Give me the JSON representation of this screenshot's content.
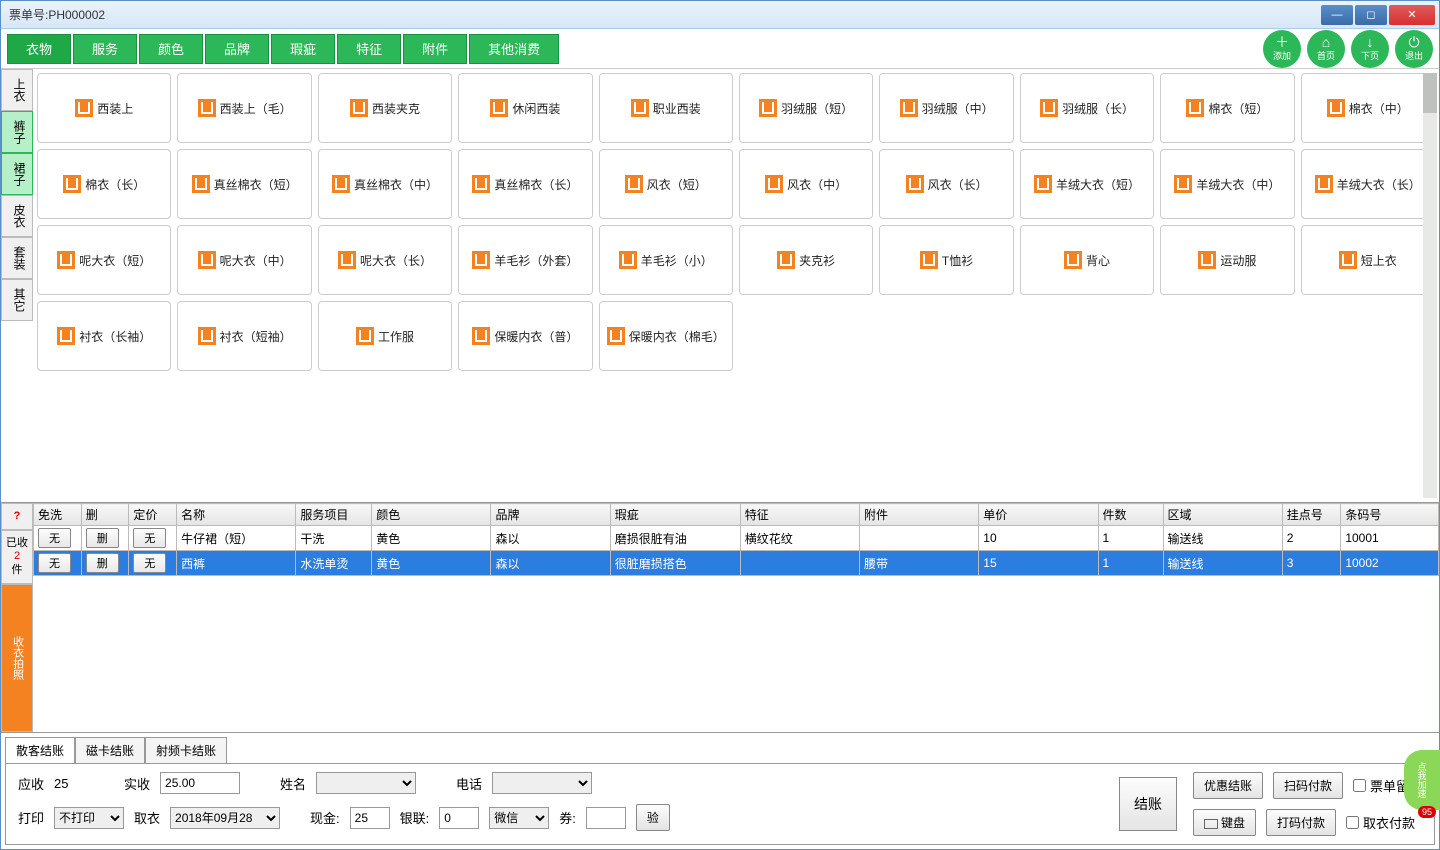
{
  "title": "票单号:PH000002",
  "tabs": [
    "衣物",
    "服务",
    "颜色",
    "品牌",
    "瑕疵",
    "特征",
    "附件",
    "其他消费"
  ],
  "circleBtns": {
    "add": "添加",
    "home": "首页",
    "next": "下页",
    "exit": "退出"
  },
  "catTabs": [
    "上衣",
    "裤子",
    "裙子",
    "皮衣",
    "套装",
    "其它"
  ],
  "items": [
    "西装上",
    "西装上（毛）",
    "西装夹克",
    "休闲西装",
    "职业西装",
    "羽绒服（短）",
    "羽绒服（中）",
    "羽绒服（长）",
    "棉衣（短）",
    "棉衣（中）",
    "棉衣（长）",
    "真丝棉衣（短）",
    "真丝棉衣（中）",
    "真丝棉衣（长）",
    "风衣（短）",
    "风衣（中）",
    "风衣（长）",
    "羊绒大衣（短）",
    "羊绒大衣（中）",
    "羊绒大衣（长）",
    "呢大衣（短）",
    "呢大衣（中）",
    "呢大衣（长）",
    "羊毛衫（外套）",
    "羊毛衫（小）",
    "夹克衫",
    "T恤衫",
    "背心",
    "运动服",
    "短上衣",
    "衬衣（长袖）",
    "衬衣（短袖）",
    "工作服",
    "保暖内衣（普）",
    "保暖内衣（棉毛）"
  ],
  "tableHeaders": [
    "免洗",
    "删",
    "定价",
    "名称",
    "服务项目",
    "颜色",
    "品牌",
    "瑕疵",
    "特征",
    "附件",
    "单价",
    "件数",
    "区域",
    "挂点号",
    "条码号"
  ],
  "qMark": "?",
  "rows": [
    {
      "name": "牛仔裙（短）",
      "serv": "干洗",
      "color": "黄色",
      "brand": "森以",
      "flaw": "磨损很脏有油",
      "feat": "横纹花纹",
      "acc": "",
      "price": "10",
      "qty": "1",
      "area": "输送线",
      "hook": "2",
      "barcode": "10001",
      "sel": false
    },
    {
      "name": "西裤",
      "serv": "水洗单烫",
      "color": "黄色",
      "brand": "森以",
      "flaw": "很脏磨损搭色",
      "feat": "",
      "acc": "腰带",
      "price": "15",
      "qty": "1",
      "area": "输送线",
      "hook": "3",
      "barcode": "10002",
      "sel": true
    }
  ],
  "miniBtns": {
    "none": "无",
    "del": "删"
  },
  "sideTabs": {
    "received": "已收",
    "count": "2",
    "unit": "件",
    "photo": "收衣拍照"
  },
  "checkoutTabs": [
    "散客结账",
    "磁卡结账",
    "射频卡结账"
  ],
  "checkout": {
    "dueLabel": "应收",
    "dueVal": "25",
    "recvLabel": "实收",
    "recvVal": "25.00",
    "nameLabel": "姓名",
    "phoneLabel": "电话",
    "printLabel": "打印",
    "printVal": "不打印",
    "pickLabel": "取衣",
    "pickVal": "2018年09月28",
    "cashLabel": "现金:",
    "cashVal": "25",
    "bankLabel": "银联:",
    "bankVal": "0",
    "wechatLabel": "微信",
    "couponLabel": "券:",
    "verify": "验",
    "settle": "结账",
    "discount": "优惠结账",
    "scanpay": "扫码付款",
    "keepTicket": "票单留店",
    "keyboard": "键盘",
    "codepay": "打码付款",
    "pickupPay": "取衣付款"
  },
  "accel": "点我加速"
}
